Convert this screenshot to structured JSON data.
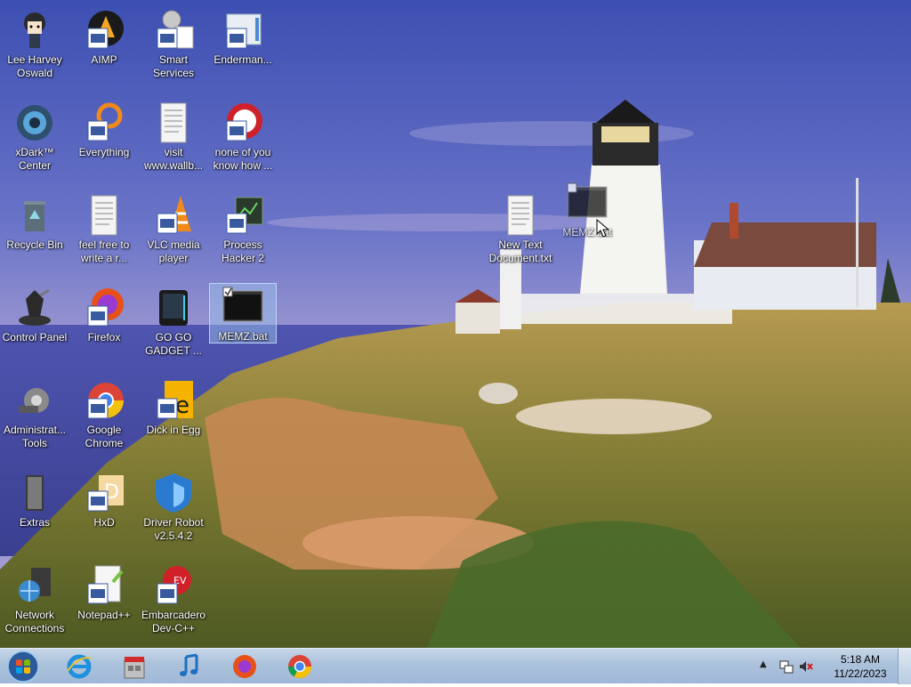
{
  "desktop": {
    "icons": [
      {
        "label": "Lee Harvey Oswald",
        "icon": "anime-character-icon"
      },
      {
        "label": "AIMP",
        "icon": "aimp-icon"
      },
      {
        "label": "Smart Services",
        "icon": "smart-services-icon"
      },
      {
        "label": "Enderman...",
        "icon": "enderman-icon"
      },
      {
        "label": "xDark™ Center",
        "icon": "xdark-center-icon"
      },
      {
        "label": "Everything",
        "icon": "everything-search-icon"
      },
      {
        "label": "visit www.wallb...",
        "icon": "text-document-icon"
      },
      {
        "label": "none of you know how ...",
        "icon": "red-circle-app-icon"
      },
      {
        "label": "Recycle Bin",
        "icon": "recycle-bin-icon"
      },
      {
        "label": "feel free to write a r...",
        "icon": "text-document-icon"
      },
      {
        "label": "VLC media player",
        "icon": "vlc-cone-icon"
      },
      {
        "label": "Process Hacker 2",
        "icon": "process-hacker-icon"
      },
      {
        "label": "Control Panel",
        "icon": "control-panel-icon"
      },
      {
        "label": "Firefox",
        "icon": "firefox-icon"
      },
      {
        "label": "GO GO GADGET ...",
        "icon": "gadget-icon"
      },
      {
        "label": "MEMZ.bat",
        "icon": "batch-file-icon"
      },
      {
        "label": "Administrat... Tools",
        "icon": "admin-tools-icon"
      },
      {
        "label": "Google Chrome",
        "icon": "chrome-icon"
      },
      {
        "label": "Dick in Egg",
        "icon": "dick-in-egg-icon"
      },
      {
        "label": "Extras",
        "icon": "extras-folder-icon"
      },
      {
        "label": "HxD",
        "icon": "hxd-icon"
      },
      {
        "label": "Driver Robot v2.5.4.2",
        "icon": "driver-robot-shield-icon"
      },
      {
        "label": "Network Connections",
        "icon": "network-connections-icon"
      },
      {
        "label": "Notepad++",
        "icon": "notepad-plus-plus-icon"
      },
      {
        "label": "Embarcadero Dev-C++",
        "icon": "devcpp-icon"
      },
      {
        "label": "New Text Document.txt",
        "icon": "text-document-icon"
      }
    ],
    "drag_ghost_label": "MEMZ.bat"
  },
  "taskbar": {
    "pinned": [
      {
        "name": "Internet Explorer",
        "icon": "internet-explorer-icon"
      },
      {
        "name": "Store",
        "icon": "store-icon"
      },
      {
        "name": "Music",
        "icon": "music-note-icon"
      },
      {
        "name": "Firefox",
        "icon": "firefox-icon"
      },
      {
        "name": "Google Chrome",
        "icon": "chrome-icon"
      }
    ],
    "clock": {
      "time": "5:18 AM",
      "date": "11/22/2023"
    }
  },
  "colors": {
    "taskbar": "#adc3dc",
    "sky": "#5a68c0",
    "grass": "#8a8a3a",
    "lighthouse": "#f4f4f0"
  }
}
